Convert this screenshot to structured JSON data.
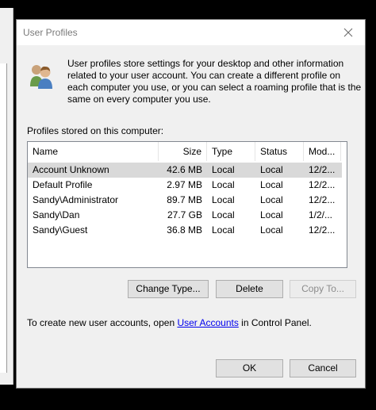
{
  "dialog": {
    "title": "User Profiles",
    "description": "User profiles store settings for your desktop and other information related to your user account. You can create a different profile on each computer you use, or you can select a roaming profile that is the same on every computer you use.",
    "profiles_label": "Profiles stored on this computer:",
    "icon": "users-icon",
    "close_icon": "close-icon"
  },
  "list": {
    "columns": [
      "Name",
      "Size",
      "Type",
      "Status",
      "Mod..."
    ],
    "rows": [
      {
        "name": "Account Unknown",
        "size": "42.6 MB",
        "type": "Local",
        "status": "Local",
        "modified": "12/2...",
        "selected": true
      },
      {
        "name": "Default Profile",
        "size": "2.97 MB",
        "type": "Local",
        "status": "Local",
        "modified": "12/2..."
      },
      {
        "name": "Sandy\\Administrator",
        "size": "89.7 MB",
        "type": "Local",
        "status": "Local",
        "modified": "12/2..."
      },
      {
        "name": "Sandy\\Dan",
        "size": "27.7 GB",
        "type": "Local",
        "status": "Local",
        "modified": "1/2/..."
      },
      {
        "name": "Sandy\\Guest",
        "size": "36.8 MB",
        "type": "Local",
        "status": "Local",
        "modified": "12/2..."
      }
    ]
  },
  "buttons": {
    "change_type": "Change Type...",
    "delete": "Delete",
    "copy_to": "Copy To...",
    "ok": "OK",
    "cancel": "Cancel"
  },
  "footer": {
    "prefix": "To create new user accounts, open ",
    "link": "User Accounts",
    "suffix": " in Control Panel."
  }
}
